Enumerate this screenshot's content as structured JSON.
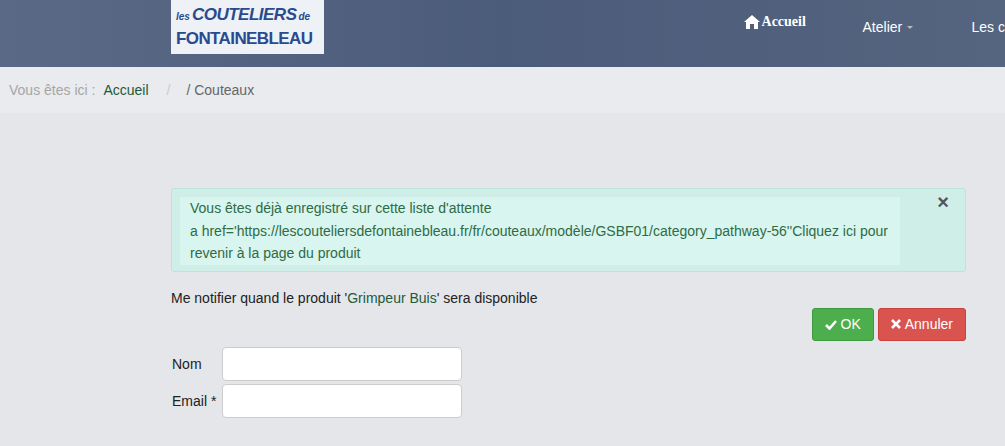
{
  "logo": {
    "small_top": "les",
    "main_top": "COUTELIERS",
    "small_mid": "de",
    "main_bottom": "FONTAINEBLEAU"
  },
  "nav": [
    {
      "label": "Accueil",
      "kind": "home",
      "selected": true
    },
    {
      "label": "Atelier",
      "kind": "dropdown",
      "selected": false
    },
    {
      "label": "Les c",
      "kind": "plain",
      "selected": false
    }
  ],
  "breadcrumb": {
    "prefix": "Vous êtes ici :",
    "items": [
      {
        "label": "Accueil",
        "kind": "link"
      },
      {
        "label": "/",
        "kind": "separator"
      },
      {
        "label": "/ Couteaux",
        "kind": "current"
      }
    ]
  },
  "alert": {
    "lines": [
      "Vous êtes déjà enregistré sur cette liste d'attente",
      "a href='https://lescouteliersdefontainebleau.fr/fr/couteaux/modèle/GSBF01/category_pathway-56''Cliquez ici pour revenir à la page du produit"
    ],
    "close": "×"
  },
  "notify": {
    "prefix": "Me notifier quand le produit '",
    "product": "Grimpeur Buis",
    "suffix": "' sera disponible"
  },
  "buttons": [
    {
      "label": "OK",
      "kind": "ok"
    },
    {
      "label": "Annuler",
      "kind": "cancel"
    }
  ],
  "fields": [
    {
      "label": "Nom",
      "value": ""
    },
    {
      "label": "Email *",
      "value": ""
    }
  ]
}
